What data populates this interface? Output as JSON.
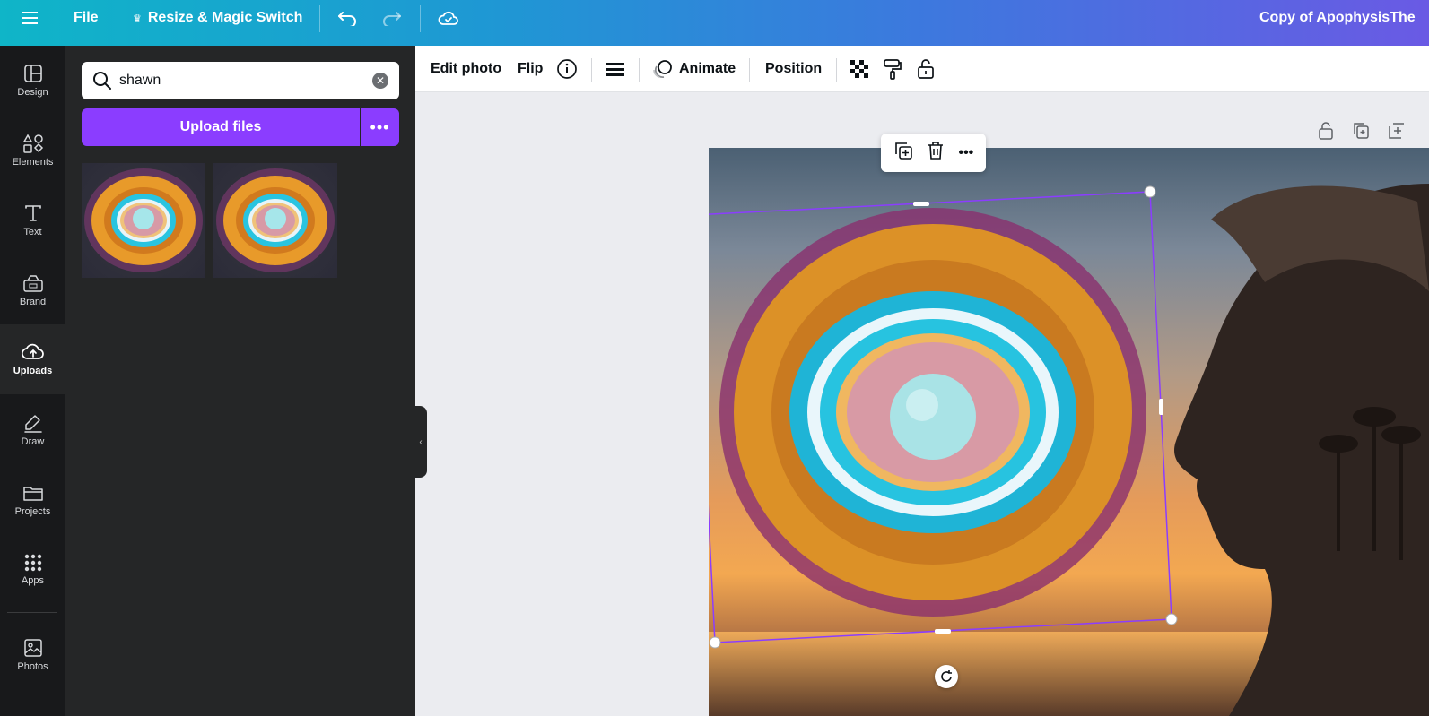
{
  "topbar": {
    "file_label": "File",
    "resize_label": "Resize & Magic Switch",
    "doc_title": "Copy of ApophysisThe"
  },
  "rail": {
    "items": [
      {
        "label": "Design"
      },
      {
        "label": "Elements"
      },
      {
        "label": "Text"
      },
      {
        "label": "Brand"
      },
      {
        "label": "Uploads"
      },
      {
        "label": "Draw"
      },
      {
        "label": "Projects"
      },
      {
        "label": "Apps"
      },
      {
        "label": "Photos"
      }
    ],
    "active": "Uploads"
  },
  "panel": {
    "search_value": "shawn",
    "upload_label": "Upload files",
    "more_label": "•••"
  },
  "toolbar": {
    "edit_photo": "Edit photo",
    "flip": "Flip",
    "animate": "Animate",
    "position": "Position"
  },
  "floating": {
    "more_label": "•••"
  },
  "colors": {
    "accent": "#8b3dff",
    "rail_bg": "#18191b",
    "panel_bg": "#252627",
    "selection": "#8b3dff"
  }
}
